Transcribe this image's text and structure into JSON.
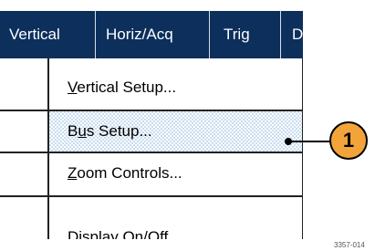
{
  "menubar": {
    "tabs": [
      {
        "label": "Vertical"
      },
      {
        "label": "Horiz/Acq"
      },
      {
        "label": "Trig"
      },
      {
        "label": "D"
      }
    ]
  },
  "dropdown": {
    "items": [
      {
        "label": "Vertical Setup...",
        "mnemonic": "V",
        "rest": "ertical Setup...",
        "selected": false
      },
      {
        "label": "Bus Setup...",
        "pre": "B",
        "mnemonic": "u",
        "rest": "s Setup...",
        "selected": true
      },
      {
        "label": "Zoom Controls...",
        "mnemonic": "Z",
        "rest": "oom Controls...",
        "selected": false
      },
      {
        "label": "Display On/Off",
        "selected": false
      }
    ]
  },
  "callout": {
    "number": "1",
    "color": "#f2a43a"
  },
  "figure_id": "3357-014",
  "colors": {
    "menubar_bg": "#0c2f5c",
    "selection_bg": "#c8dcef"
  }
}
